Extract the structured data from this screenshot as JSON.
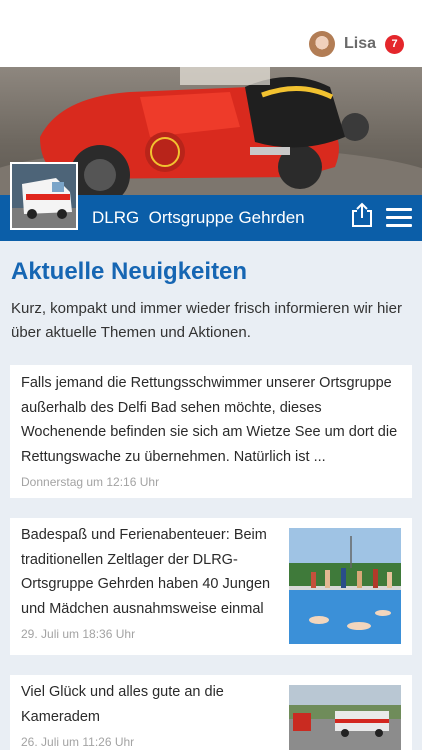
{
  "user": {
    "name": "Lisa",
    "notification_count": "7"
  },
  "org": {
    "title": "DLRG  Ortsgruppe Gehrden"
  },
  "section": {
    "title": "Aktuelle Neuigkeiten",
    "intro": "Kurz, kompakt und immer wieder frisch informieren wir hier über aktuelle Themen und Aktionen."
  },
  "news": [
    {
      "text": "Falls jemand die Rettungsschwimmer unserer Ortsgruppe außerhalb des Delfi Bad sehen möchte, dieses Wochenende befinden sie sich am Wietze See um dort die Rettungswache zu übernehmen. Natürlich ist ...",
      "date": "Donnerstag um 12:16 Uhr"
    },
    {
      "text": "Badespaß und Ferienabenteuer: Beim traditionellen Zeltlager der DLRG-Ortsgruppe Gehrden haben 40 Jungen und Mädchen ausnahmsweise einmal",
      "date": "29. Juli um 18:36 Uhr"
    },
    {
      "text": "Viel Glück und alles gute an die Kameradem",
      "date": "26. Juli um 11:26 Uhr"
    }
  ],
  "colors": {
    "brand_blue": "#0b5ea8",
    "heading_blue": "#1666b3",
    "badge_red": "#e4262b"
  },
  "icons": {
    "share": "share-icon",
    "menu": "hamburger-menu-icon"
  }
}
